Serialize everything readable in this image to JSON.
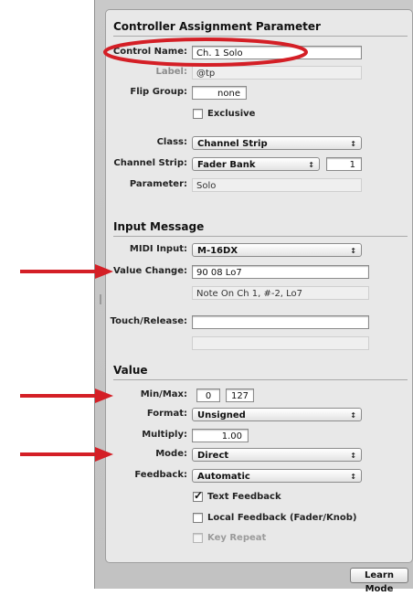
{
  "sections": {
    "controller": "Controller Assignment Parameter",
    "input": "Input Message",
    "value": "Value"
  },
  "controller": {
    "control_name_label": "Control Name:",
    "control_name_value": "Ch. 1 Solo",
    "label_label": "Label:",
    "label_value": "@tp",
    "flip_group_label": "Flip Group:",
    "flip_group_value": "none",
    "exclusive_label": "Exclusive",
    "class_label": "Class:",
    "class_value": "Channel Strip",
    "channel_strip_label": "Channel Strip:",
    "channel_strip_value": "Fader Bank",
    "channel_strip_number": "1",
    "parameter_label": "Parameter:",
    "parameter_value": "Solo"
  },
  "input": {
    "midi_input_label": "MIDI Input:",
    "midi_input_value": "M-16DX",
    "value_change_label": "Value Change:",
    "value_change_value": "90 08 Lo7",
    "value_change_desc": "Note On Ch 1, #-2, Lo7",
    "touch_release_label": "Touch/Release:",
    "touch_release_value": ""
  },
  "value": {
    "min_max_label": "Min/Max:",
    "min_value": "0",
    "max_value": "127",
    "format_label": "Format:",
    "format_value": "Unsigned",
    "multiply_label": "Multiply:",
    "multiply_value": "1.00",
    "mode_label": "Mode:",
    "mode_value": "Direct",
    "feedback_label": "Feedback:",
    "feedback_value": "Automatic",
    "text_feedback_label": "Text Feedback",
    "text_feedback_checked": true,
    "local_feedback_label": "Local Feedback (Fader/Knob)",
    "local_feedback_checked": false,
    "key_repeat_label": "Key Repeat",
    "key_repeat_enabled": false
  },
  "footer": {
    "learn_mode_label": "Learn Mode"
  },
  "annotation_color": "#d41f26",
  "icons": {
    "popup_arrow": "updown-chevron-icon"
  }
}
